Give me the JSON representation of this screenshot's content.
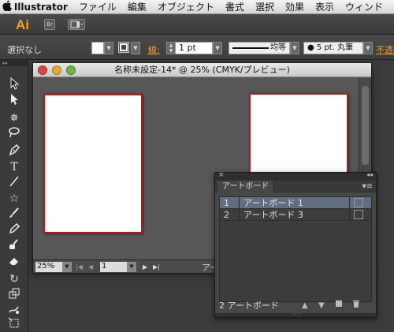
{
  "menubar": {
    "apple": "",
    "app": "Illustrator",
    "items": [
      "ファイル",
      "編集",
      "オブジェクト",
      "書式",
      "選択",
      "効果",
      "表示",
      "ウィンド"
    ]
  },
  "appbar": {
    "logo": "Ai",
    "bridge_label": "Br"
  },
  "control": {
    "selection": "選択なし",
    "stroke_label": "線:",
    "stroke_value": "1 pt",
    "stroke_profile": "均等",
    "brush": "5 pt. 丸筆",
    "opacity_link": "不透明"
  },
  "document": {
    "title": "名称未設定-14* @ 25% (CMYK/プレビュー)",
    "zoom": "25%",
    "page": "1",
    "status_text": "アー"
  },
  "panel": {
    "tab": "アートボード",
    "rows": [
      {
        "num": "1",
        "name": "アートボード 1"
      },
      {
        "num": "2",
        "name": "アートボード 3"
      }
    ],
    "footer_count": "2 アートボード"
  },
  "icons": [
    "apple-icon",
    "bridge-icon",
    "arrange-icon",
    "stroke-swatch-icon",
    "selection-tool-icon",
    "direct-selection-tool-icon",
    "magic-wand-icon",
    "lasso-icon",
    "pen-icon",
    "type-icon",
    "line-icon",
    "star-icon",
    "paintbrush-icon",
    "pencil-icon",
    "blob-brush-icon",
    "eraser-icon",
    "rotate-icon",
    "scale-icon",
    "warp-icon",
    "free-transform-icon"
  ],
  "colors": {
    "artboard_border": "#b0171b",
    "ai_orange": "#f7a21b",
    "selected_row": "#5f6e82"
  }
}
